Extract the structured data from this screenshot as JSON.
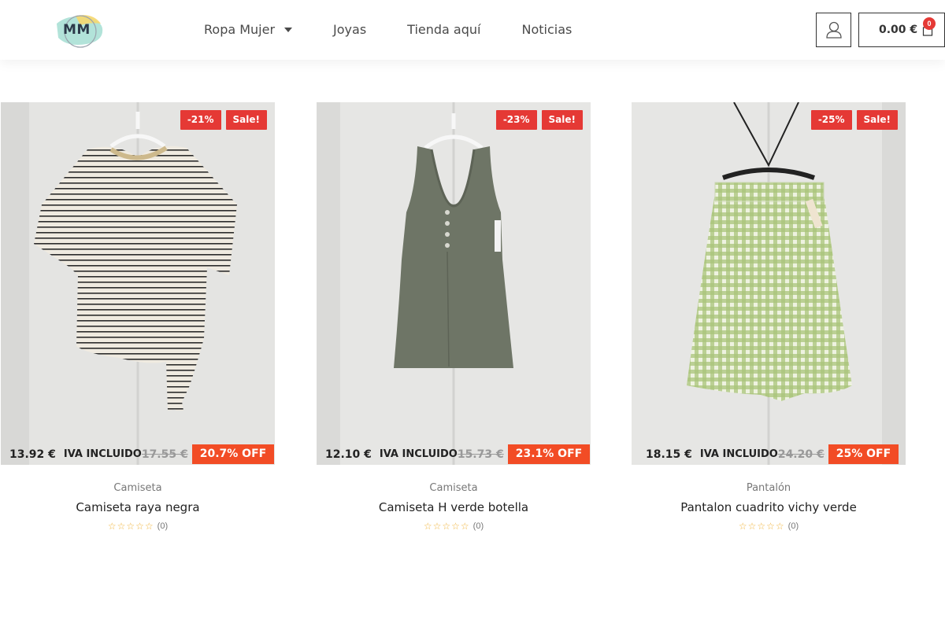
{
  "header": {
    "logo_text": "MM",
    "nav": [
      {
        "label": "Ropa Mujer",
        "has_dropdown": true
      },
      {
        "label": "Joyas"
      },
      {
        "label": "Tienda aquí"
      },
      {
        "label": "Noticias"
      }
    ],
    "cart_total": "0.00 €",
    "cart_count": "0"
  },
  "products": [
    {
      "badge_discount": "-21%",
      "badge_sale": "Sale!",
      "category": "Camiseta",
      "title": "Camiseta raya negra",
      "rating_count": "(0)",
      "price": "13.92 €",
      "iva": "IVA INCLUIDO",
      "old_price": "17.55 €",
      "off": "20.7% OFF"
    },
    {
      "badge_discount": "-23%",
      "badge_sale": "Sale!",
      "category": "Camiseta",
      "title": "Camiseta H verde botella",
      "rating_count": "(0)",
      "price": "12.10 €",
      "iva": "IVA INCLUIDO",
      "old_price": "15.73 €",
      "off": "23.1% OFF"
    },
    {
      "badge_discount": "-25%",
      "badge_sale": "Sale!",
      "category": "Pantalón",
      "title": "Pantalon cuadrito vichy verde",
      "rating_count": "(0)",
      "price": "18.15 €",
      "iva": "IVA INCLUIDO",
      "old_price": "24.20 €",
      "off": "25% OFF"
    }
  ],
  "colors": {
    "sale_red": "#e53935",
    "off_orange": "#f24c25",
    "star": "#f0b43c"
  }
}
